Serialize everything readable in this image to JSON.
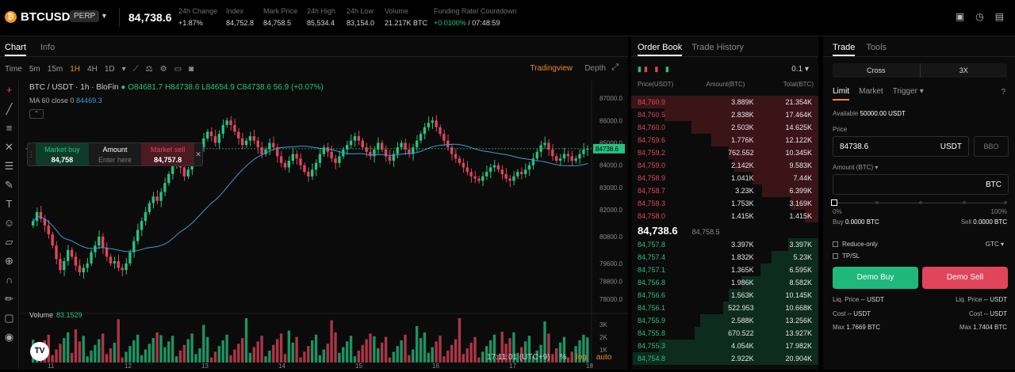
{
  "header": {
    "logo_letter": "₿",
    "symbol": "BTCUSDT",
    "contract_type": "PERP",
    "last_price": "84,738.6",
    "stats": [
      {
        "label": "24h Change",
        "value": "+1.87%"
      },
      {
        "label": "Index",
        "value": "84,752.8"
      },
      {
        "label": "Mark Price",
        "value": "84,758.5"
      },
      {
        "label": "24h High",
        "value": "85,534.4"
      },
      {
        "label": "24h Low",
        "value": "83,154.0"
      },
      {
        "label": "Volume",
        "value": "21.217K BTC"
      },
      {
        "label": "Funding Rate/ Countdown",
        "value": "+0.0100% / 07:48:59"
      }
    ]
  },
  "chart_panel": {
    "tabs": [
      "Chart",
      "Info"
    ],
    "intervals": [
      "Time",
      "5m",
      "15m",
      "1H",
      "4H",
      "1D"
    ],
    "active_interval": "1H",
    "tradingview_label": "Tradingview",
    "depth_label": "Depth",
    "legend": {
      "title": "BTC / USDT · 1h · BloFin",
      "ohlc": "O84681.7 H84738.6 L84654.9 C84738.6 56.9 (+0.07%)",
      "ma_label": "MA 60 close 0",
      "ma_value": "84469.3"
    },
    "ticket": {
      "buy_label": "Market buy",
      "buy_value": "84,758",
      "amount_label": "Amount",
      "amount_placeholder": "Enter here",
      "sell_label": "Market sell",
      "sell_value": "84,757.8"
    },
    "volume_label": "Volume",
    "volume_value": "83.1529",
    "price_axis": [
      "87000.0",
      "86000.0",
      "85000.0",
      "84000.0",
      "83000.0",
      "82000.0",
      "80800.0",
      "79600.0",
      "78800.0",
      "78000.0"
    ],
    "volume_axis": [
      "3K",
      "2K",
      "1K"
    ],
    "time_axis": [
      "11",
      "12",
      "13",
      "14",
      "15",
      "16",
      "17",
      "18"
    ],
    "price_tag": "84738.6",
    "clock": "17:11:01 (UTC+9)",
    "footer_pct": "%",
    "footer_log": "log",
    "footer_auto": "auto"
  },
  "chart_data": {
    "type": "candlestick",
    "x_range_days": [
      "11",
      "18"
    ],
    "ylim": [
      77500,
      87500
    ],
    "ma_period": 60,
    "last_close": 84738.6,
    "closes": [
      81500,
      81900,
      81600,
      81300,
      80900,
      80400,
      79800,
      79300,
      79700,
      80200,
      79900,
      79500,
      79200,
      79400,
      79600,
      80100,
      80400,
      80800,
      80300,
      79900,
      79600,
      79700,
      79400,
      79300,
      79600,
      80100,
      80600,
      81100,
      81500,
      81900,
      82300,
      82600,
      82400,
      82800,
      83200,
      83600,
      84000,
      84200,
      83900,
      83500,
      83800,
      84200,
      84500,
      84800,
      85200,
      85500,
      85300,
      85000,
      85400,
      85800,
      86000,
      85800,
      85500,
      85200,
      84900,
      85100,
      85300,
      85100,
      84800,
      84500,
      84700,
      85000,
      84800,
      84400,
      84100,
      83900,
      84200,
      84500,
      84300,
      84000,
      83700,
      83500,
      83800,
      84100,
      84500,
      84800,
      84600,
      84300,
      84100,
      84400,
      84700,
      84900,
      85100,
      85300,
      85100,
      84800,
      84600,
      84400,
      84700,
      85000,
      84700,
      84400,
      84200,
      84500,
      84800,
      85000,
      84700,
      84500,
      84800,
      85100,
      85400,
      85700,
      85900,
      86000,
      85700,
      85400,
      85100,
      84800,
      84500,
      84300,
      84100,
      83900,
      83700,
      83500,
      83400,
      83300,
      83500,
      83700,
      83900,
      84000,
      83800,
      83600,
      83400,
      83300,
      83500,
      83700,
      83600,
      83800,
      84000,
      84300,
      84600,
      84900,
      85000,
      84700,
      84400,
      84200,
      84300,
      84500,
      84400,
      84200,
      84300,
      84500,
      84700,
      84738.6
    ],
    "volume_scale_max": 3500
  },
  "order_book": {
    "tabs": [
      "Order Book",
      "Trade History"
    ],
    "tick_size": "0.1",
    "headers": [
      "Price(USDT)",
      "Amount(BTC)",
      "Total(BTC)"
    ],
    "asks": [
      {
        "price": "84,760.9",
        "amount": "3.889K",
        "total": "21.354K",
        "depth": 1.0
      },
      {
        "price": "84,760.5",
        "amount": "2.838K",
        "total": "17.464K",
        "depth": 0.82
      },
      {
        "price": "84,760.0",
        "amount": "2.503K",
        "total": "14.625K",
        "depth": 0.68
      },
      {
        "price": "84,759.6",
        "amount": "1.776K",
        "total": "12.122K",
        "depth": 0.57
      },
      {
        "price": "84,759.2",
        "amount": "762.552",
        "total": "10.345K",
        "depth": 0.48
      },
      {
        "price": "84,759.0",
        "amount": "2.142K",
        "total": "9.583K",
        "depth": 0.45
      },
      {
        "price": "84,758.9",
        "amount": "1.041K",
        "total": "7.44K",
        "depth": 0.35
      },
      {
        "price": "84,758.7",
        "amount": "3.23K",
        "total": "6.399K",
        "depth": 0.3
      },
      {
        "price": "84,758.3",
        "amount": "1.753K",
        "total": "3.169K",
        "depth": 0.15
      },
      {
        "price": "84,758.0",
        "amount": "1.415K",
        "total": "1.415K",
        "depth": 0.07
      }
    ],
    "mid_price": "84,738.6",
    "mid_index": "84,758.5",
    "bids": [
      {
        "price": "84,757.8",
        "amount": "3.397K",
        "total": "3.397K",
        "depth": 0.16
      },
      {
        "price": "84,757.4",
        "amount": "1.832K",
        "total": "5.23K",
        "depth": 0.25
      },
      {
        "price": "84,757.1",
        "amount": "1.365K",
        "total": "6.595K",
        "depth": 0.31
      },
      {
        "price": "84,756.8",
        "amount": "1.986K",
        "total": "8.582K",
        "depth": 0.41
      },
      {
        "price": "84,756.6",
        "amount": "1.563K",
        "total": "10.145K",
        "depth": 0.48
      },
      {
        "price": "84,756.1",
        "amount": "522.953",
        "total": "10.668K",
        "depth": 0.51
      },
      {
        "price": "84,755.9",
        "amount": "2.588K",
        "total": "13.256K",
        "depth": 0.63
      },
      {
        "price": "84,755.8",
        "amount": "670.522",
        "total": "13.927K",
        "depth": 0.66
      },
      {
        "price": "84,755.3",
        "amount": "4.054K",
        "total": "17.982K",
        "depth": 0.85
      },
      {
        "price": "84,754.8",
        "amount": "2.922K",
        "total": "20.904K",
        "depth": 0.99
      }
    ]
  },
  "trade": {
    "tabs": [
      "Trade",
      "Tools"
    ],
    "margin_mode": "Cross",
    "leverage": "3X",
    "order_types": [
      "Limit",
      "Market",
      "Trigger ▾"
    ],
    "available_label": "Available",
    "available_value": "50000.00 USDT",
    "price_label": "Price",
    "price_value": "84738.6",
    "price_unit": "USDT",
    "bbo_label": "BBO",
    "amount_label": "Amount (BTC) ▾",
    "amount_unit": "BTC",
    "slider_min": "0%",
    "slider_max": "100%",
    "slider_fraction": 0,
    "buy_label": "Buy",
    "buy_value": "0.0000 BTC",
    "sell_label": "Sell",
    "sell_value": "0.0000 BTC",
    "reduce_only": "Reduce-only",
    "tpsl": "TP/SL",
    "tif": "GTC ▾",
    "demo_buy": "Demo Buy",
    "demo_sell": "Demo Sell",
    "liq_label": "Liq. Price",
    "liq_value": "-- USDT",
    "cost_label": "Cost",
    "cost_value": "-- USDT",
    "max_label": "Max",
    "max_buy": "1.7669 BTC",
    "max_sell": "1.7404 BTC"
  },
  "colors": {
    "up": "#26c281",
    "down": "#e0455b",
    "accent": "#f08a24",
    "ma": "#3b9bd6"
  }
}
